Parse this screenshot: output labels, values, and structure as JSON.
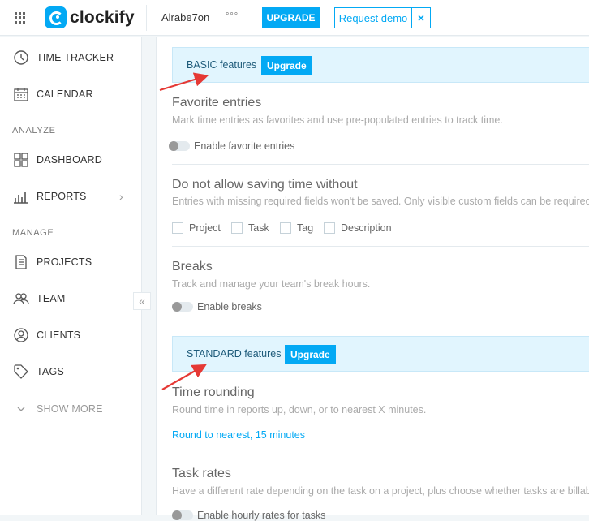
{
  "topbar": {
    "logo_text": "clockify",
    "workspace": "Alrabe7on",
    "more_dots": "°°°",
    "upgrade_label": "UPGRADE",
    "request_demo_label": "Request demo",
    "close_label": "×"
  },
  "sidebar": {
    "time_tracker": "TIME TRACKER",
    "calendar": "CALENDAR",
    "analyze_section": "ANALYZE",
    "dashboard": "DASHBOARD",
    "reports": "REPORTS",
    "manage_section": "MANAGE",
    "projects": "PROJECTS",
    "team": "TEAM",
    "clients": "CLIENTS",
    "tags": "TAGS",
    "show_more": "SHOW MORE",
    "collapse_label": "«"
  },
  "content": {
    "basic_banner": {
      "label": "BASIC features",
      "button": "Upgrade"
    },
    "favorite": {
      "title": "Favorite entries",
      "description": "Mark time entries as favorites and use pre-populated entries to track time.",
      "toggle_label": "Enable favorite entries"
    },
    "required_fields": {
      "title": "Do not allow saving time without",
      "description": "Entries with missing required fields won't be saved. Only visible custom fields can be required.",
      "options": [
        "Project",
        "Task",
        "Tag",
        "Description"
      ]
    },
    "breaks": {
      "title": "Breaks",
      "description": "Track and manage your team's break hours.",
      "toggle_label": "Enable breaks"
    },
    "standard_banner": {
      "label": "STANDARD features",
      "button": "Upgrade"
    },
    "time_rounding": {
      "title": "Time rounding",
      "description": "Round time in reports up, down, or to nearest X minutes.",
      "link": "Round to nearest, 15 minutes"
    },
    "task_rates": {
      "title": "Task rates",
      "description": "Have a different rate depending on the task on a project, plus choose whether tasks are billable.",
      "toggle_label": "Enable hourly rates for tasks"
    }
  },
  "colors": {
    "accent": "#03a9f4",
    "banner_bg": "#e1f5fe",
    "annotation_arrow": "#e53935"
  }
}
